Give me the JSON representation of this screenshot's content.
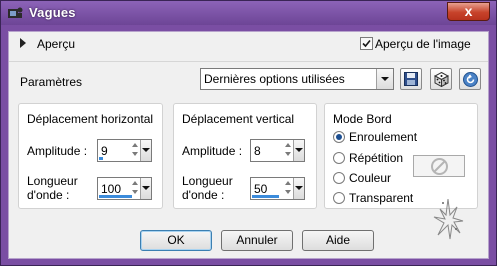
{
  "window": {
    "title": "Vagues",
    "close_glyph": "x"
  },
  "preview": {
    "expander_label": "Aperçu",
    "checkbox_label": "Aperçu de l'image",
    "checkbox_checked": true
  },
  "params": {
    "label": "Paramètres",
    "preset_value": "Dernières options utilisées",
    "icons": [
      "save-icon",
      "dice-icon",
      "reset-icon"
    ]
  },
  "horizontal": {
    "title": "Déplacement horizontal",
    "amplitude_label": "Amplitude :",
    "amplitude_value": "9",
    "wavelength_label": "Longueur\nd'onde :",
    "wavelength_value": "100"
  },
  "vertical": {
    "title": "Déplacement vertical",
    "amplitude_label": "Amplitude :",
    "amplitude_value": "8",
    "wavelength_label": "Longueur\nd'onde :",
    "wavelength_value": "50"
  },
  "edge_mode": {
    "title": "Mode Bord",
    "options": [
      "Enroulement",
      "Répétition",
      "Couleur",
      "Transparent"
    ],
    "selected": "Enroulement"
  },
  "buttons": {
    "ok": "OK",
    "cancel": "Annuler",
    "help": "Aide"
  },
  "colors": {
    "title_bg": "#7a4ea3",
    "close_bg": "#c7432b",
    "panel_bg": "#f0f0f0",
    "accent_bar": "#3b8bdb"
  }
}
